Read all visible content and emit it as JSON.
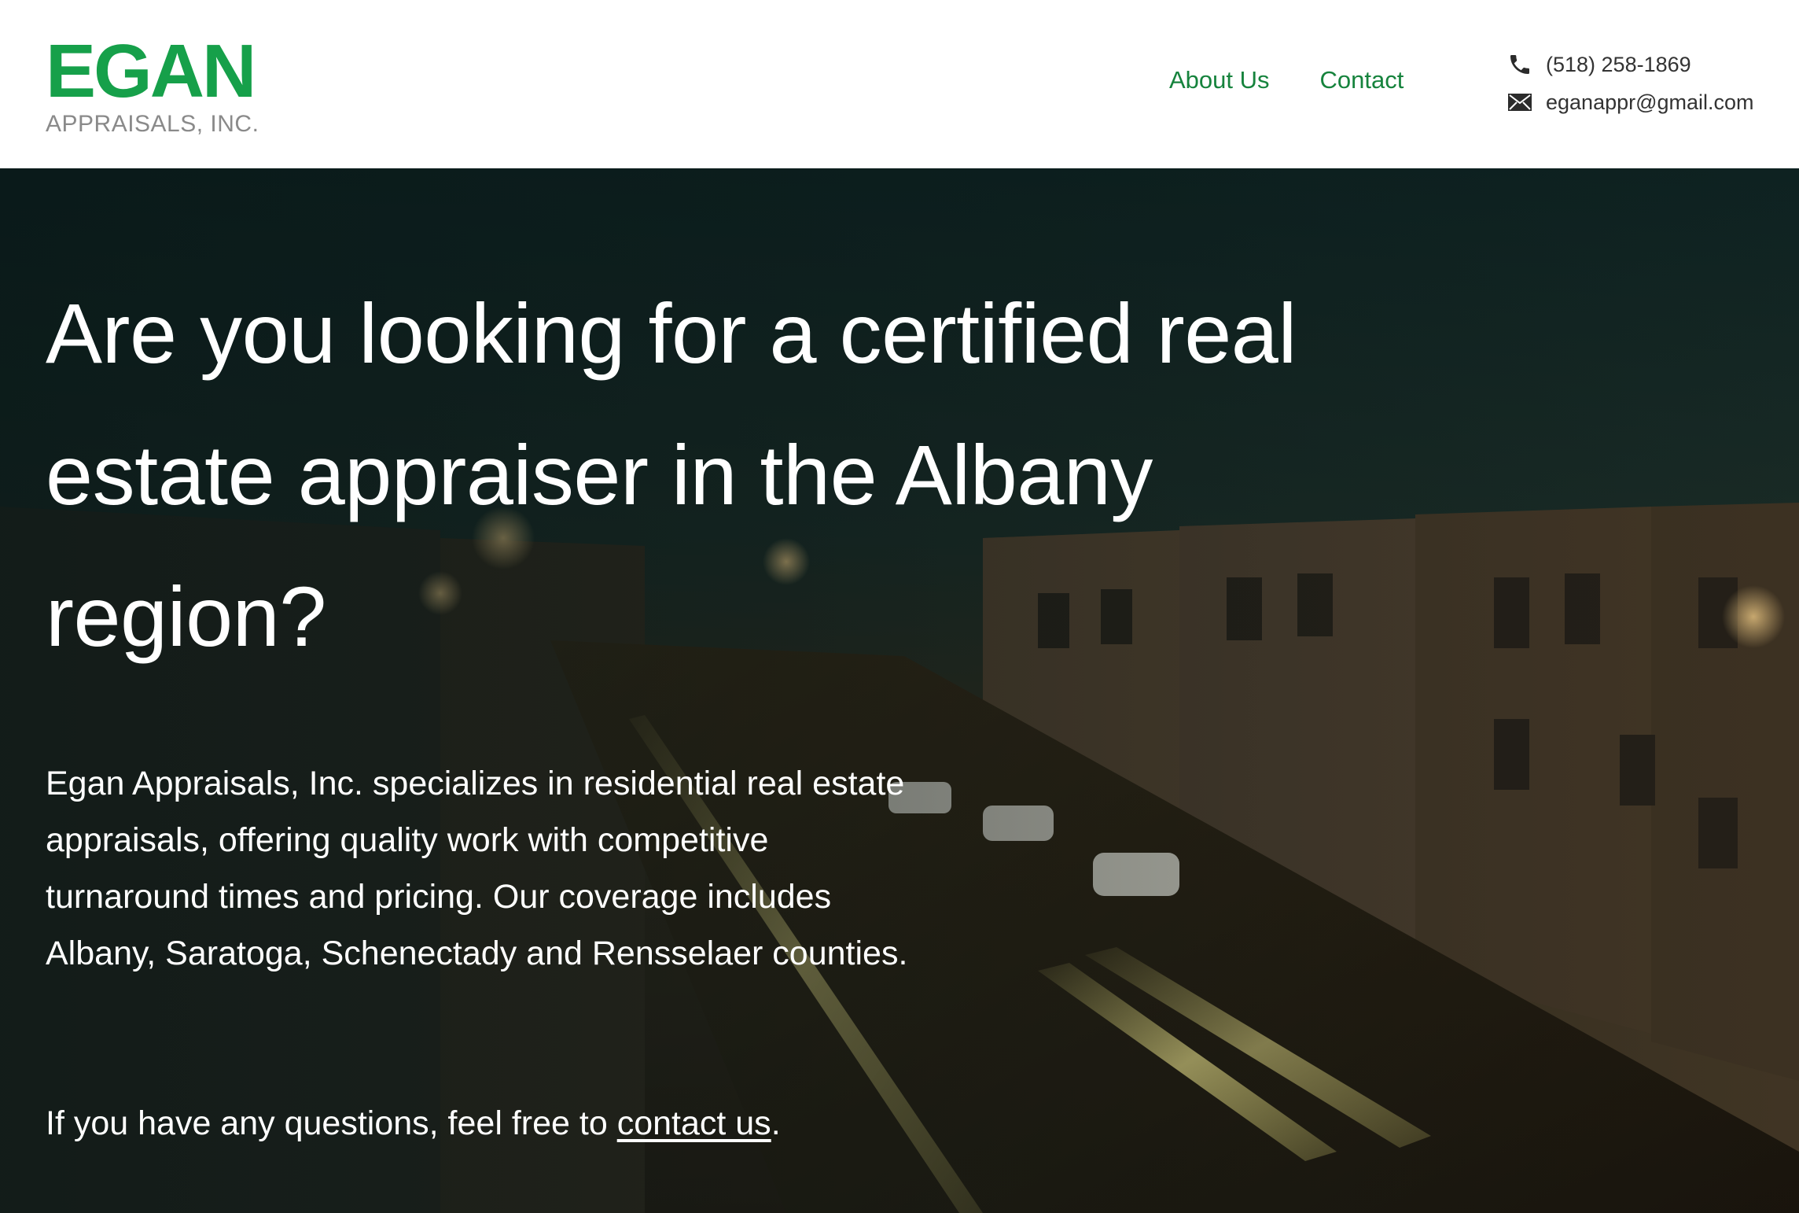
{
  "header": {
    "logo_main": "EGAN",
    "logo_sub": "APPRAISALS, INC.",
    "nav": [
      {
        "label": "About Us"
      },
      {
        "label": "Contact"
      }
    ],
    "phone": "(518) 258-1869",
    "email": "eganappr@gmail.com",
    "brand_color": "#16a04a",
    "nav_color": "#16833d"
  },
  "hero": {
    "title": "Are you looking for a certified real estate appraiser in the Albany region?",
    "description": "Egan Appraisals, Inc. specializes in residential real estate appraisals, offering quality work with competitive turnaround times and pricing. Our coverage includes Albany, Saratoga, Schenectady and Rensselaer counties.",
    "cta_prefix": "If you have any questions, feel free to ",
    "cta_link": "contact us",
    "cta_suffix": "."
  },
  "icons": {
    "phone": "phone-icon",
    "email": "envelope-icon"
  }
}
